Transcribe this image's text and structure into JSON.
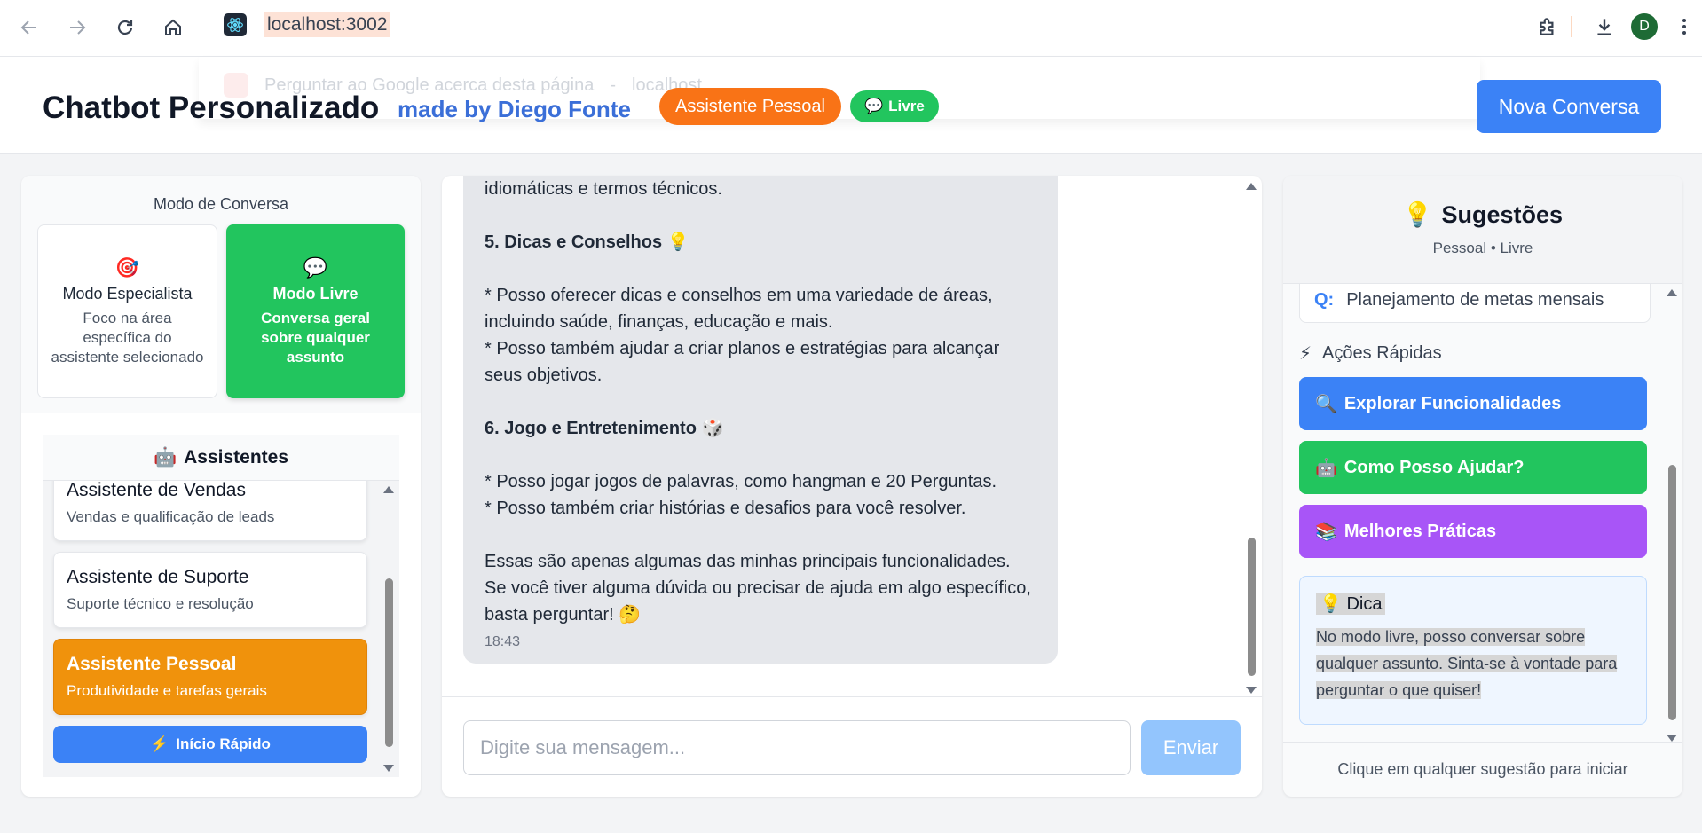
{
  "browser": {
    "url": "localhost:3002",
    "omnibox_suggestion": "Perguntar ao Google acerca desta página",
    "omnibox_suggestion_host": "localhost",
    "profile_initial": "D"
  },
  "header": {
    "title": "Chatbot Personalizado",
    "made_by": "made by Diego Fonte",
    "assistant_badge": "Assistente Pessoal",
    "mode_badge": "Livre",
    "new_chat": "Nova Conversa"
  },
  "modes": {
    "title": "Modo de Conversa",
    "specialist": {
      "name": "Modo Especialista",
      "desc": "Foco na área específica do assistente selecionado"
    },
    "free": {
      "name": "Modo Livre",
      "desc": "Conversa geral sobre qualquer assunto"
    }
  },
  "assistants": {
    "title": "Assistentes",
    "items": [
      {
        "name": "Assistente de Vendas",
        "desc": "Vendas e qualificação de leads"
      },
      {
        "name": "Assistente de Suporte",
        "desc": "Suporte técnico e resolução"
      },
      {
        "name": "Assistente Pessoal",
        "desc": "Produtividade e tarefas gerais"
      }
    ],
    "quick_start": "Início Rápido"
  },
  "chat": {
    "message_lines": [
      "idiomáticas e termos técnicos.",
      "",
      "5. Dicas e Conselhos",
      "",
      "* Posso oferecer dicas e conselhos em uma variedade de áreas, incluindo saúde, finanças, educação e mais.",
      "* Posso também ajudar a criar planos e estratégias para alcançar seus objetivos.",
      "",
      "6. Jogo e Entretenimento",
      "",
      "* Posso jogar jogos de palavras, como hangman e 20 Perguntas.",
      "* Posso também criar histórias e desafios para você resolver.",
      "",
      "Essas são apenas algumas das minhas principais funcionalidades. Se você tiver alguma dúvida ou precisar de ajuda em algo específico, basta perguntar!"
    ],
    "timestamp": "18:43",
    "input_placeholder": "Digite sua mensagem...",
    "send": "Enviar"
  },
  "suggestions": {
    "title": "Sugestões",
    "subtitle": "Pessoal • Livre",
    "question_prefix": "Q:",
    "question": "Planejamento de metas mensais",
    "quick_actions_title": "Ações Rápidas",
    "actions": [
      {
        "label": "Explorar Funcionalidades",
        "color": "#3b82f6"
      },
      {
        "label": "Como Posso Ajudar?",
        "color": "#22c55e"
      },
      {
        "label": "Melhores Práticas",
        "color": "#a855f7"
      }
    ],
    "tip_title": "Dica",
    "tip_text": "No modo livre, posso conversar sobre qualquer assunto. Sinta-se à vontade para perguntar o que quiser!",
    "footer": "Clique em qualquer sugestão para iniciar"
  }
}
